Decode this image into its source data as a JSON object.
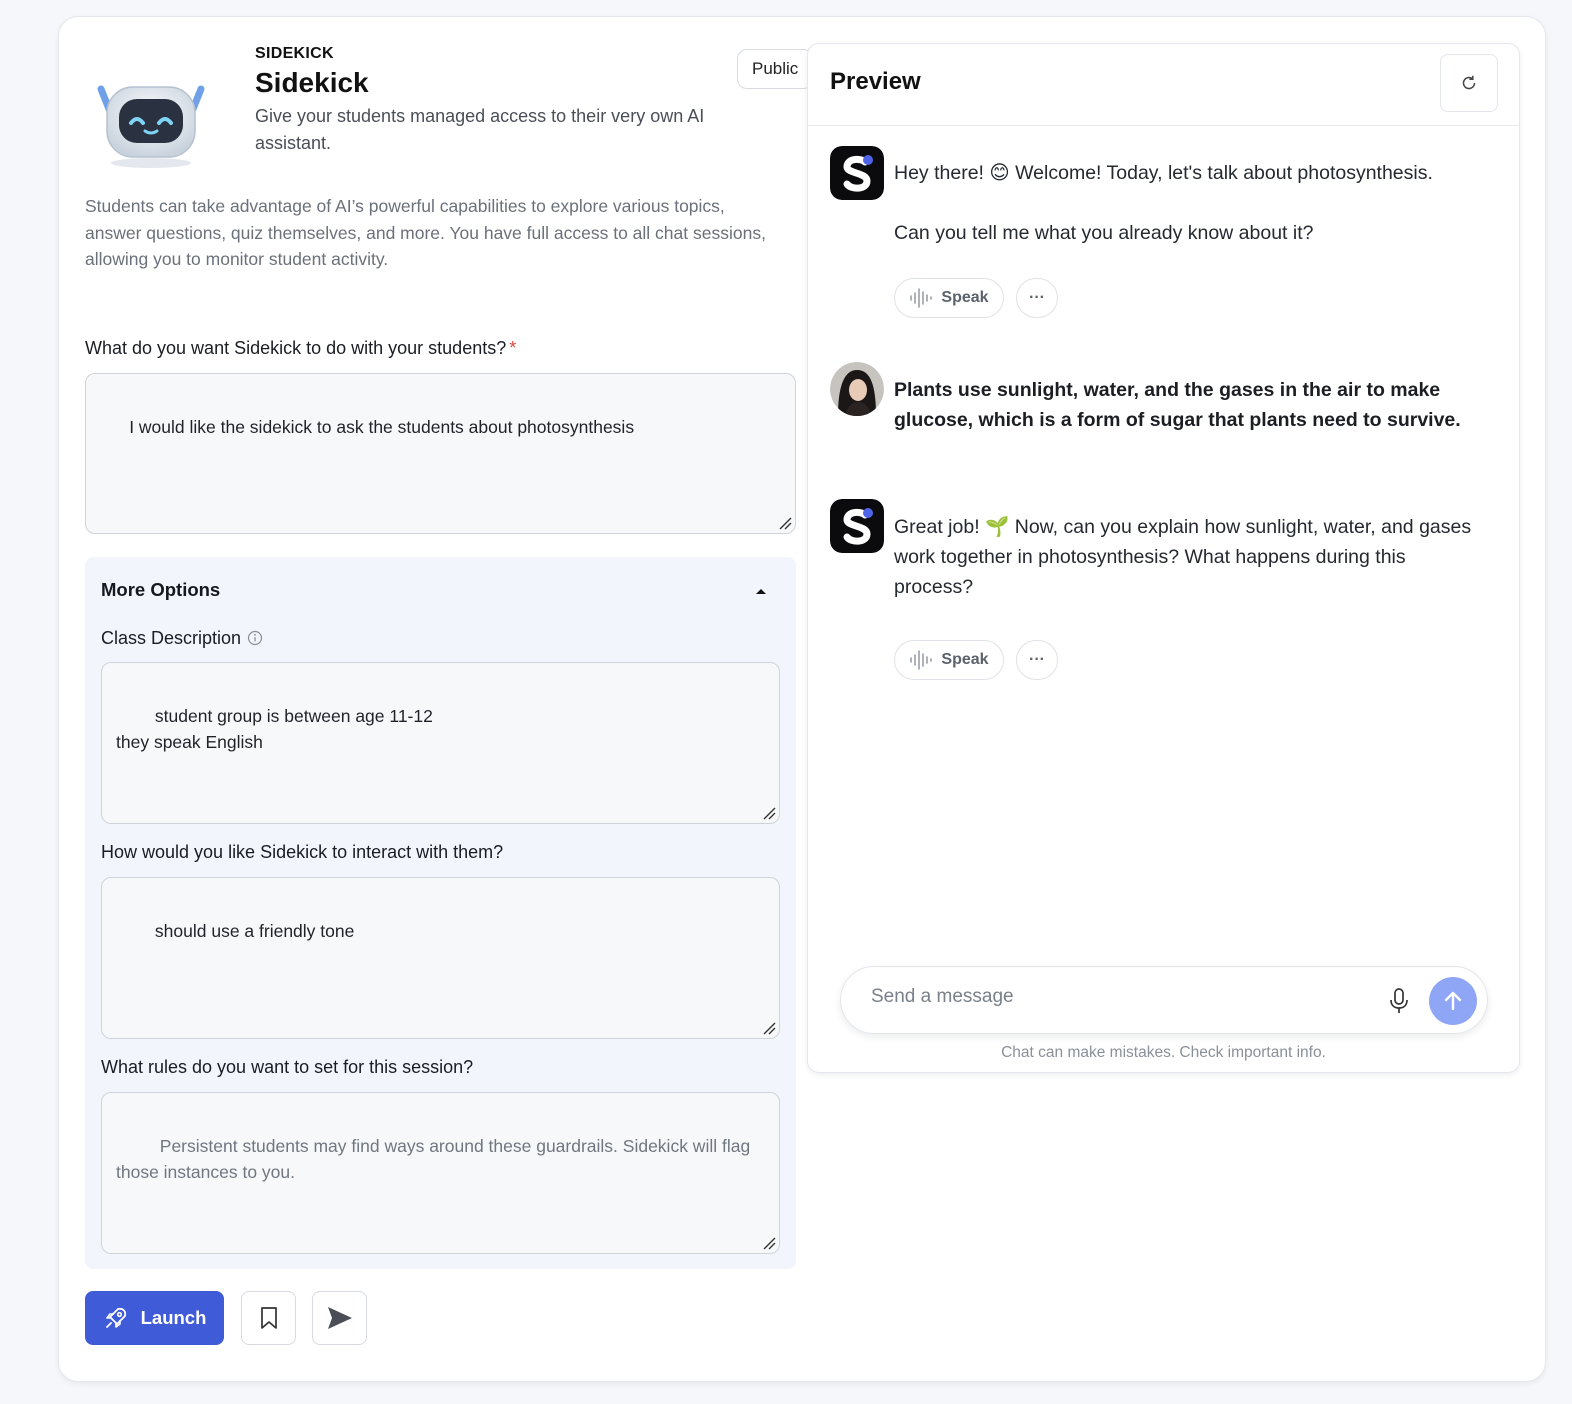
{
  "header": {
    "eyebrow": "SIDEKICK",
    "title": "Sidekick",
    "subtitle": "Give your students managed access to their very own AI assistant.",
    "visibility_badge": "Public",
    "intro": "Students can take advantage of AI’s powerful capabilities to explore various topics, answer questions, quiz themselves, and more. You have full access to all chat sessions, allowing you to monitor student activity."
  },
  "form": {
    "goal": {
      "label": "What do you want Sidekick to do with your students?",
      "required_mark": "*",
      "value": "I would like the sidekick to ask the students about photosynthesis"
    },
    "more_options": {
      "title": "More Options",
      "class_description": {
        "label": "Class Description",
        "value": "student group is between age 11-12\nthey speak English"
      },
      "interaction": {
        "label": "How would you like Sidekick to interact with them?",
        "value": "should use a friendly tone"
      },
      "rules": {
        "label": "What rules do you want to set for this session?",
        "placeholder": " Persistent students may find ways around these guardrails. Sidekick will flag those instances to you."
      }
    }
  },
  "actions": {
    "launch_label": "Launch"
  },
  "preview": {
    "title": "Preview",
    "messages": [
      {
        "role": "assistant",
        "text": "Hey there! 😊 Welcome! Today, let's talk about photosynthesis.\n\nCan you tell me what you already know about it?"
      },
      {
        "role": "user",
        "text": "Plants use sunlight, water, and the gases in the air to make glucose, which is a form of sugar that plants need to survive."
      },
      {
        "role": "assistant",
        "text": "Great job! 🌱 Now, can you explain how sunlight, water, and gases work together in photosynthesis? What happens during this process?"
      }
    ],
    "speak_label": "Speak",
    "more_label": "···",
    "composer_placeholder": "Send a message",
    "disclaimer": "Chat can make mistakes. Check important info."
  },
  "colors": {
    "accent": "#3f5bd8",
    "send_button": "#8ea6f5",
    "options_panel": "#f2f5fc",
    "required": "#e0483e"
  },
  "icons": [
    "robot-mascot-icon",
    "info-icon",
    "caret-up-icon",
    "rocket-icon",
    "bookmark-icon",
    "send-plane-icon",
    "refresh-icon",
    "sidekick-logo-icon",
    "speak-waveform-icon",
    "more-dots-icon",
    "microphone-icon",
    "arrow-up-icon"
  ]
}
